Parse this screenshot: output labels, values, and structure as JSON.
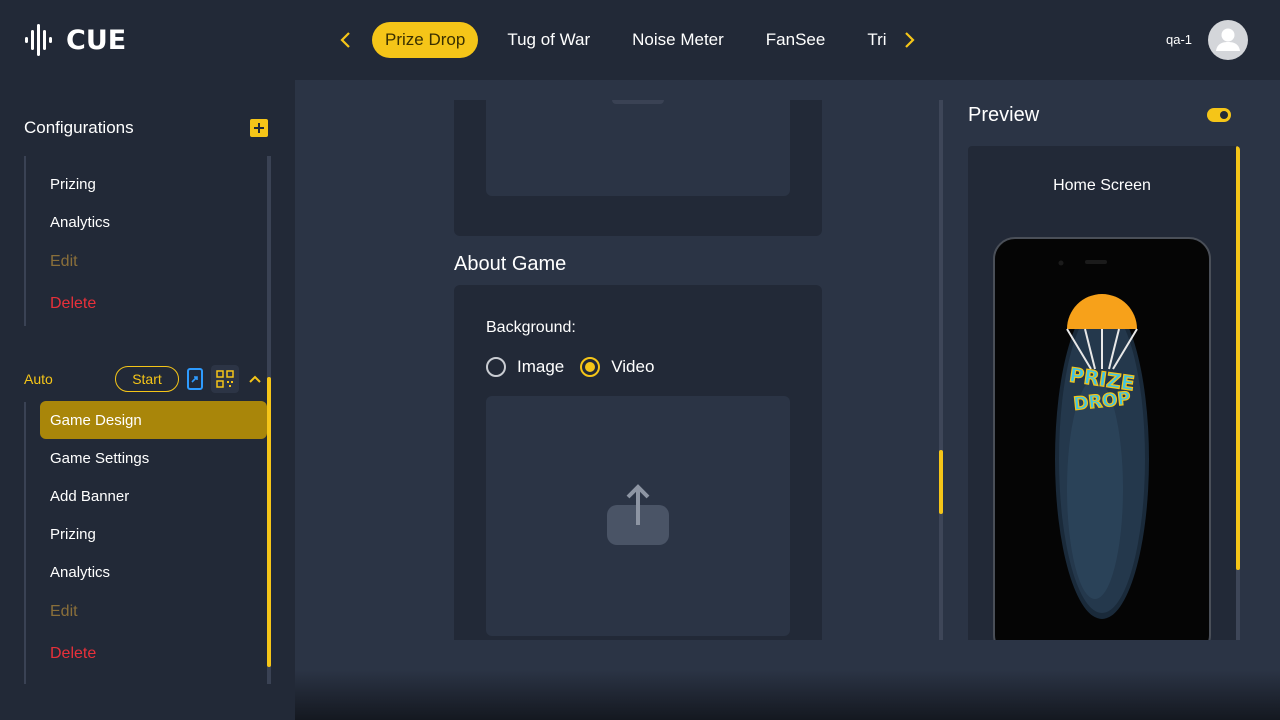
{
  "app": {
    "logo_text": "CUE"
  },
  "nav": {
    "tabs": [
      {
        "label": "Prize Drop",
        "active": true
      },
      {
        "label": "Tug of War",
        "active": false
      },
      {
        "label": "Noise Meter",
        "active": false
      },
      {
        "label": "FanSee",
        "active": false
      },
      {
        "label": "Trivia",
        "active": false
      }
    ],
    "prev_icon": "chevron-left-icon",
    "next_icon": "chevron-right-icon"
  },
  "user": {
    "name": "qa-1",
    "avatar_icon": "user-avatar-icon"
  },
  "sidebar": {
    "title": "Configurations",
    "add_icon": "plus-icon",
    "group1_items": [
      {
        "label": "Prizing",
        "style": "normal"
      },
      {
        "label": "Analytics",
        "style": "normal"
      },
      {
        "label": "Edit",
        "style": "muted"
      },
      {
        "label": "Delete",
        "style": "danger"
      }
    ],
    "group2": {
      "label": "Auto",
      "start_label": "Start",
      "items": [
        {
          "label": "Game Design",
          "style": "active"
        },
        {
          "label": "Game Settings",
          "style": "normal"
        },
        {
          "label": "Add Banner",
          "style": "normal"
        },
        {
          "label": "Prizing",
          "style": "normal"
        },
        {
          "label": "Analytics",
          "style": "normal"
        },
        {
          "label": "Edit",
          "style": "muted"
        },
        {
          "label": "Delete",
          "style": "danger"
        }
      ]
    }
  },
  "main": {
    "about_title": "About Game",
    "background_label": "Background:",
    "radio_options": [
      {
        "label": "Image",
        "checked": false
      },
      {
        "label": "Video",
        "checked": true
      }
    ],
    "upload_icon": "upload-icon"
  },
  "preview": {
    "title": "Preview",
    "screen_label": "Home Screen",
    "game_logo_line1": "PRIZE",
    "game_logo_line2": "DROP"
  },
  "colors": {
    "accent": "#f5c518",
    "danger": "#e8303a",
    "muted": "#8a6f3a",
    "panel": "#222937",
    "content": "#2b3445"
  }
}
